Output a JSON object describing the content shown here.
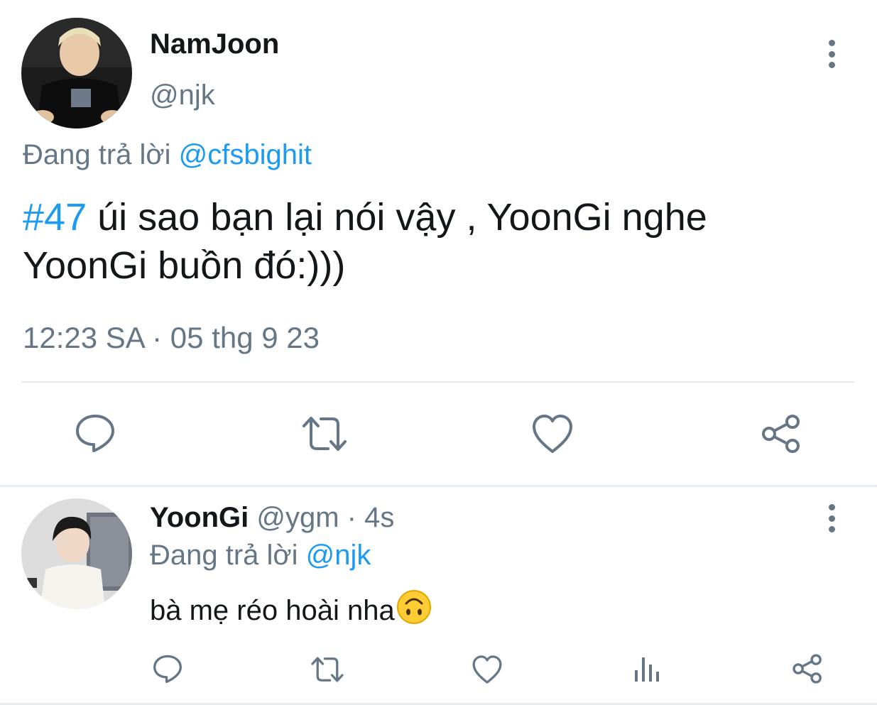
{
  "main_tweet": {
    "display_name": "NamJoon",
    "handle": "@njk",
    "replying_prefix": "Đang trả lời",
    "replying_to": "@cfsbighit",
    "hashtag": "#47",
    "text_line1": " úi sao bạn lại nói vậy , YoonGi nghe",
    "text_line2": "YoonGi buồn đó:)))",
    "timestamp": "12:23 SA · 05 thg 9 23",
    "actions": [
      "reply-icon",
      "retweet-icon",
      "like-icon",
      "share-icon"
    ]
  },
  "reply_tweet": {
    "display_name": "YoonGi",
    "handle": "@ygm",
    "time": " · 4s",
    "replying_prefix": "Đang trả lời",
    "replying_to": "@njk",
    "text": "bà mẹ réo hoài nha",
    "emoji": "upside-down-face-emoji",
    "actions": [
      "reply-icon",
      "retweet-icon",
      "like-icon",
      "analytics-icon",
      "share-icon"
    ]
  },
  "colors": {
    "accent": "#1d9bf0",
    "muted": "#657786",
    "text": "#14171a",
    "divider": "#e6ecf0"
  }
}
